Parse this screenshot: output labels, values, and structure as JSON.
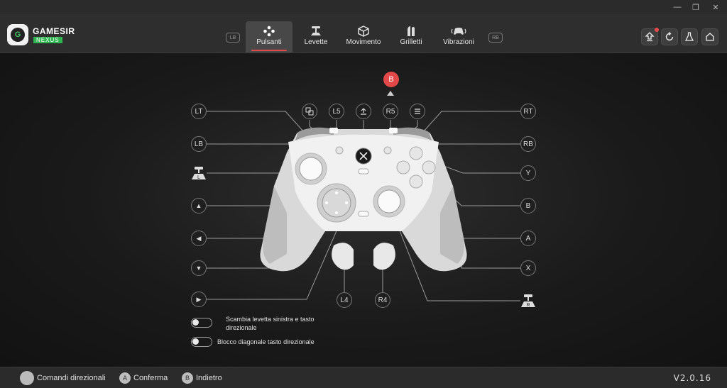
{
  "window": {
    "minimize_icon": "minimize-icon",
    "restore_icon": "restore-icon",
    "close_icon": "close-icon"
  },
  "app": {
    "brand": "GAMESIR",
    "brand_sub": "NEXUS"
  },
  "tabs": [
    {
      "label": "Pulsanti",
      "icon": "buttons-icon",
      "active": true
    },
    {
      "label": "Levette",
      "icon": "stick-icon",
      "active": false
    },
    {
      "label": "Movimento",
      "icon": "motion-cube-icon",
      "active": false
    },
    {
      "label": "Grilletti",
      "icon": "trigger-icon",
      "active": false
    },
    {
      "label": "Vibrazioni",
      "icon": "vibration-icon",
      "active": false
    }
  ],
  "bumper_hints": {
    "left": "LB",
    "right": "RB"
  },
  "header_buttons": [
    {
      "name": "firmware-update",
      "icon": "upload-arrow-icon",
      "badge": true
    },
    {
      "name": "reset",
      "icon": "refresh-icon",
      "badge": false
    },
    {
      "name": "test",
      "icon": "flask-icon",
      "badge": false
    },
    {
      "name": "home",
      "icon": "home-icon",
      "badge": false
    }
  ],
  "selected_button": "B",
  "labels": {
    "left": [
      "LT",
      "LB",
      "▲",
      "◀",
      "▼",
      "▶"
    ],
    "right": [
      "RT",
      "RB",
      "Y",
      "B",
      "A",
      "X"
    ],
    "top": [
      "L5",
      "R5"
    ],
    "bottom": [
      "L4",
      "R4"
    ],
    "left_stick": "L",
    "right_stick": "R"
  },
  "options": [
    {
      "label": "Scambia levetta sinistra e tasto direzionale",
      "enabled": false
    },
    {
      "label": "Blocco diagonale tasto direzionale",
      "enabled": false
    }
  ],
  "footer": {
    "hints": [
      {
        "key": "",
        "label": "Comandi direzionali"
      },
      {
        "key": "A",
        "label": "Conferma"
      },
      {
        "key": "B",
        "label": "Indietro"
      }
    ],
    "version": "V2.0.16"
  },
  "colors": {
    "accent": "#e34949",
    "green": "#2fb54f",
    "background": "#151515",
    "controller": "#e6e6e6"
  }
}
